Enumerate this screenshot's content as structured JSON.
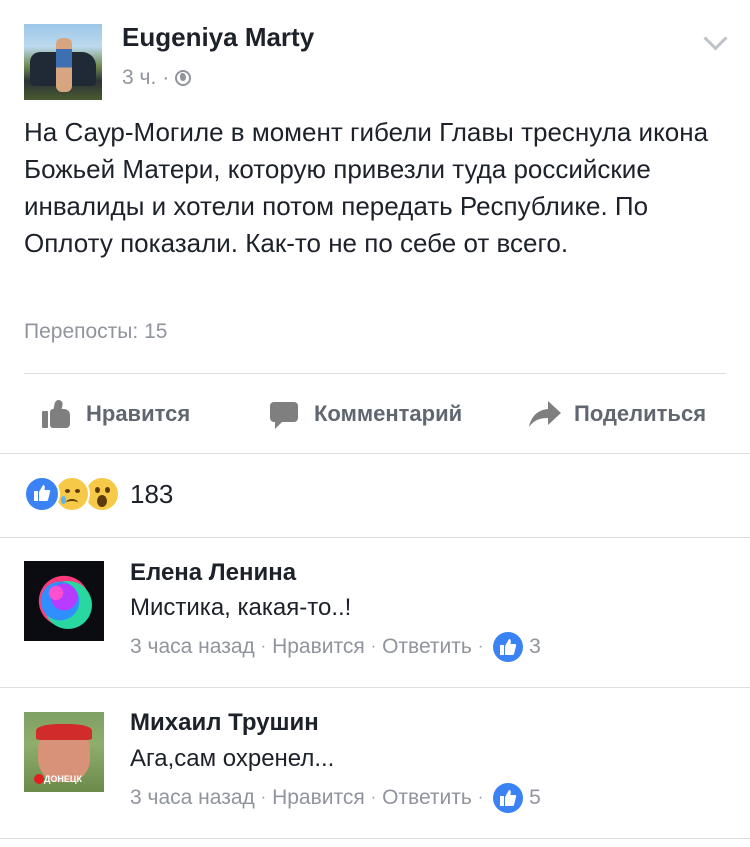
{
  "post": {
    "author": "Eugeniya Marty",
    "time": "3 ч.",
    "separator": "·",
    "privacy_icon": "globe-icon",
    "menu_icon": "chevron-down-icon",
    "text": "На Саур-Могиле в момент гибели Главы треснула икона Божьей Матери, которую привезли туда российские инвалиды и хотели потом передать Республике. По Оплоту показали. Как-то не по себе от всего.",
    "shares": "Перепосты: 15"
  },
  "actions": {
    "like": "Нравится",
    "comment": "Комментарий",
    "share": "Поделиться"
  },
  "reactions": {
    "icons": [
      "like-icon",
      "sad-icon",
      "wow-icon"
    ],
    "count": "183"
  },
  "comments": [
    {
      "name": "Елена Ленина",
      "text": "Мистика, какая-то..!",
      "time": "3 часа назад",
      "like": "Нравится",
      "reply": "Ответить",
      "likes": "3"
    },
    {
      "name": "Михаил Трушин",
      "text": "Ага,сам охренел...",
      "time": "3 часа назад",
      "like": "Нравится",
      "reply": "Ответить",
      "likes": "5"
    }
  ],
  "colors": {
    "text": "#1d2129",
    "secondary": "#90949c",
    "action": "#606770",
    "divider": "#dddfe2",
    "like_blue": "#3b82f5"
  }
}
